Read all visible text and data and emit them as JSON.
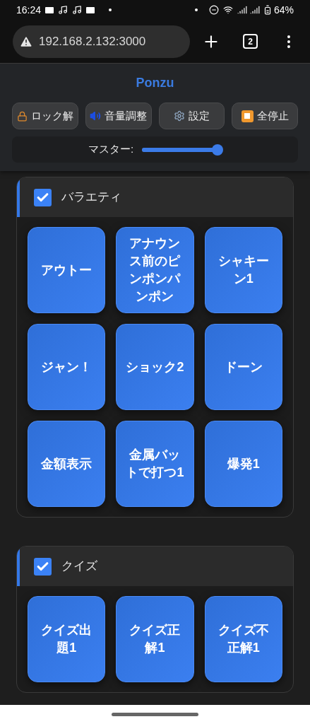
{
  "status_bar": {
    "time": "16:24",
    "battery": "64%"
  },
  "browser": {
    "url": "192.168.2.132:3000",
    "tab_count": "2"
  },
  "app": {
    "title": "Ponzu",
    "toolbar": [
      {
        "label": "ロック解",
        "kind": "lock"
      },
      {
        "label": "音量調整",
        "kind": "volume"
      },
      {
        "label": "設定",
        "kind": "settings"
      },
      {
        "label": "全停止",
        "kind": "stop"
      }
    ],
    "master": {
      "label": "マスター:",
      "level": 0.95
    }
  },
  "sections": [
    {
      "title": "バラエティ",
      "checked": true,
      "buttons": [
        {
          "label": "アウトー"
        },
        {
          "label": "アナウンス前のピンポンパンポン"
        },
        {
          "label": "シャキーン1"
        },
        {
          "label": "ジャン！"
        },
        {
          "label": "ショック2"
        },
        {
          "label": "ドーン"
        },
        {
          "label": "金額表示"
        },
        {
          "label": "金属バットで打つ1"
        },
        {
          "label": "爆発1"
        }
      ]
    },
    {
      "title": "クイズ",
      "checked": true,
      "buttons": [
        {
          "label": "クイズ出題1"
        },
        {
          "label": "クイズ正解1"
        },
        {
          "label": "クイズ不正解1"
        }
      ]
    }
  ]
}
